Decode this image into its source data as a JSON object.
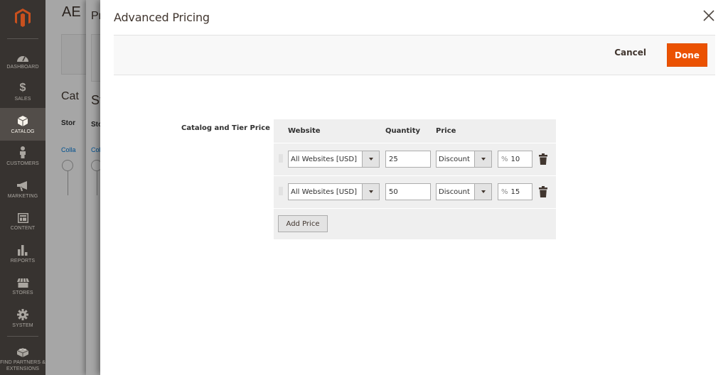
{
  "sidebar": {
    "items": [
      {
        "label": "Dashboard",
        "icon": "dashboard-icon"
      },
      {
        "label": "Sales",
        "icon": "dollar-icon"
      },
      {
        "label": "Catalog",
        "icon": "box-icon",
        "active": true
      },
      {
        "label": "Customers",
        "icon": "person-icon"
      },
      {
        "label": "Marketing",
        "icon": "megaphone-icon"
      },
      {
        "label": "Content",
        "icon": "layout-icon"
      },
      {
        "label": "Reports",
        "icon": "bar-chart-icon"
      },
      {
        "label": "Stores",
        "icon": "storefront-icon"
      },
      {
        "label": "System",
        "icon": "gear-icon"
      },
      {
        "label": "Find Partners & Extensions",
        "icon": "lego-block-icon"
      }
    ]
  },
  "background": {
    "title1": "AE",
    "title2": "Pr",
    "heading1": "Cat",
    "heading2": "St",
    "bold1": "Stor",
    "bold2": "Sto",
    "link1": "Colla",
    "link2": "Col"
  },
  "modal": {
    "title": "Advanced Pricing",
    "cancel_label": "Cancel",
    "done_label": "Done",
    "field_label": "Catalog and Tier Price",
    "columns": {
      "website": "Website",
      "quantity": "Quantity",
      "price": "Price"
    },
    "rows": [
      {
        "website": "All Websites [USD]",
        "quantity": "25",
        "price_type": "Discount",
        "price_symbol": "%",
        "price_value": "10"
      },
      {
        "website": "All Websites [USD]",
        "quantity": "50",
        "price_type": "Discount",
        "price_symbol": "%",
        "price_value": "15"
      }
    ],
    "add_price_label": "Add Price"
  },
  "colors": {
    "accent": "#eb5202",
    "sidebar_bg": "#373330",
    "sidebar_active": "#524d49"
  }
}
